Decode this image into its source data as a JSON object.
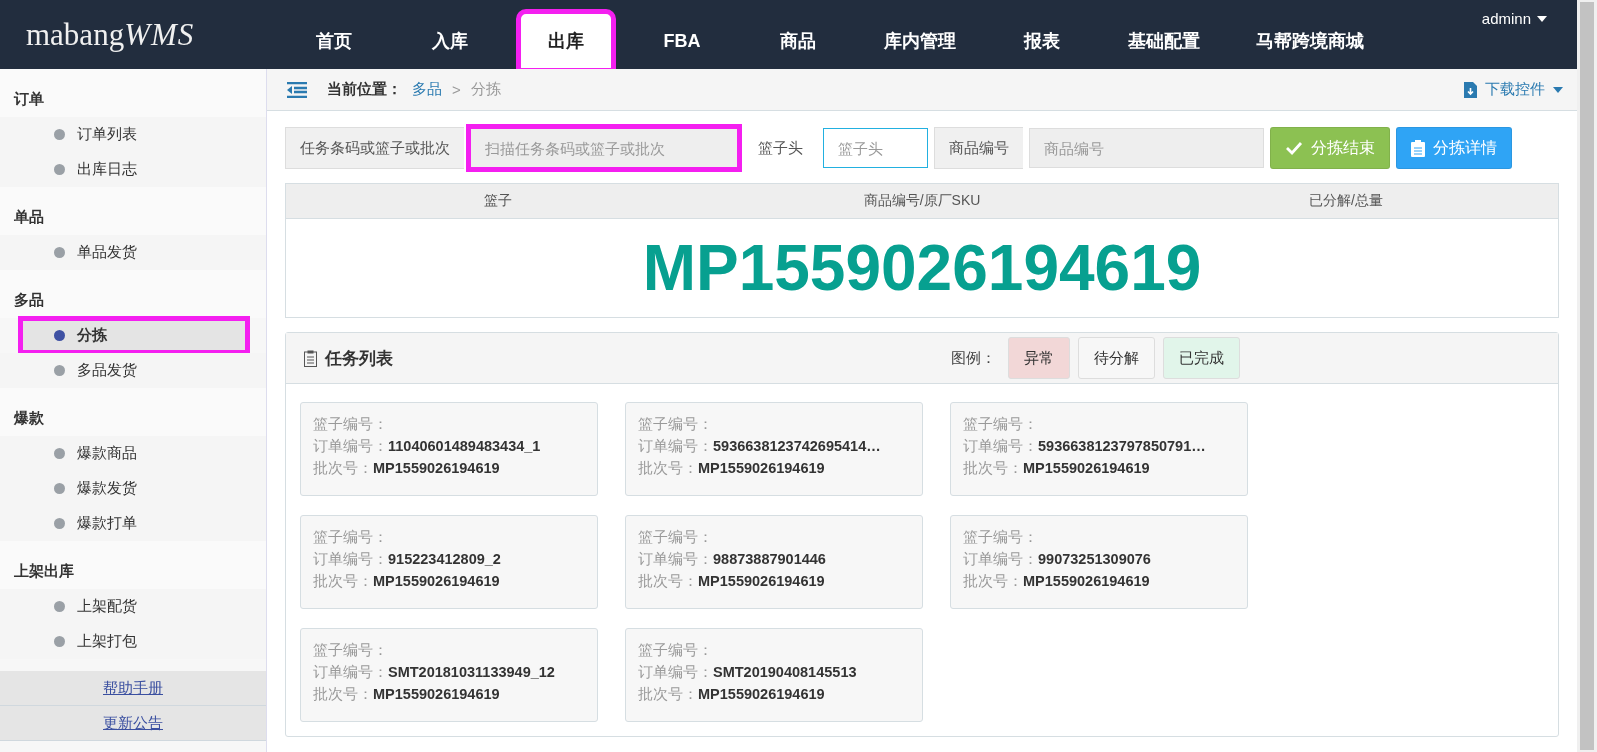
{
  "header": {
    "logo_text": "mabang",
    "logo_suffix": "WMS",
    "user": "adminn",
    "nav": [
      {
        "label": "首页",
        "selected": false,
        "highlighted": false
      },
      {
        "label": "入库",
        "selected": false,
        "highlighted": false
      },
      {
        "label": "出库",
        "selected": true,
        "highlighted": true
      },
      {
        "label": "FBA",
        "selected": false,
        "highlighted": false
      },
      {
        "label": "商品",
        "selected": false,
        "highlighted": false
      },
      {
        "label": "库内管理",
        "selected": false,
        "highlighted": false
      },
      {
        "label": "报表",
        "selected": false,
        "highlighted": false
      },
      {
        "label": "基础配置",
        "selected": false,
        "highlighted": false
      },
      {
        "label": "马帮跨境商城",
        "selected": false,
        "highlighted": false
      }
    ]
  },
  "sidebar": {
    "groups": [
      {
        "title": "订单",
        "items": [
          {
            "label": "订单列表",
            "selected": false,
            "highlighted": false
          },
          {
            "label": "出库日志",
            "selected": false,
            "highlighted": false
          }
        ]
      },
      {
        "title": "单品",
        "items": [
          {
            "label": "单品发货",
            "selected": false,
            "highlighted": false
          }
        ]
      },
      {
        "title": "多品",
        "items": [
          {
            "label": "分拣",
            "selected": true,
            "highlighted": true
          },
          {
            "label": "多品发货",
            "selected": false,
            "highlighted": false
          }
        ]
      },
      {
        "title": "爆款",
        "items": [
          {
            "label": "爆款商品",
            "selected": false,
            "highlighted": false
          },
          {
            "label": "爆款发货",
            "selected": false,
            "highlighted": false
          },
          {
            "label": "爆款打单",
            "selected": false,
            "highlighted": false
          }
        ]
      },
      {
        "title": "上架出库",
        "items": [
          {
            "label": "上架配货",
            "selected": false,
            "highlighted": false
          },
          {
            "label": "上架打包",
            "selected": false,
            "highlighted": false
          }
        ]
      }
    ],
    "links": [
      "帮助手册",
      "更新公告"
    ]
  },
  "breadcrumb": {
    "label": "当前位置：",
    "path": [
      "多品",
      "分拣"
    ],
    "separator": ">",
    "download": "下载控件"
  },
  "scan_form": {
    "fields": [
      {
        "label": "任务条码或篮子或批次",
        "placeholder": "扫描任务条码或篮子或批次",
        "highlighted": true,
        "focused": false
      },
      {
        "label": "篮子头",
        "placeholder": "篮子头",
        "highlighted": false,
        "focused": true
      },
      {
        "label": "商品编号",
        "placeholder": "商品编号",
        "highlighted": false,
        "focused": false
      }
    ],
    "buttons": [
      {
        "label": "分拣结束",
        "kind": "finish"
      },
      {
        "label": "分拣详情",
        "kind": "detail"
      }
    ]
  },
  "result_table": {
    "columns": [
      "篮子",
      "商品编号/原厂SKU",
      "已分解/总量"
    ],
    "batch": "MP1559026194619"
  },
  "task_list": {
    "title": "任务列表",
    "legend_label": "图例：",
    "legend": [
      {
        "label": "异常",
        "kind": "abnormal"
      },
      {
        "label": "待分解",
        "kind": "pending"
      },
      {
        "label": "已完成",
        "kind": "done"
      }
    ],
    "cards": [
      {
        "kind": "pending",
        "basket_label": "篮子编号：",
        "order_label": "订单编号：",
        "order": "11040601489483434_1",
        "batch_label": "批次号：",
        "batch": "MP1559026194619"
      },
      {
        "kind": "pending",
        "basket_label": "篮子编号：",
        "order_label": "订单编号：",
        "order": "5936638123742695414…",
        "batch_label": "批次号：",
        "batch": "MP1559026194619"
      },
      {
        "kind": "pending",
        "basket_label": "篮子编号：",
        "order_label": "订单编号：",
        "order": "5936638123797850791…",
        "batch_label": "批次号：",
        "batch": "MP1559026194619"
      },
      {
        "kind": "pending",
        "basket_label": "篮子编号：",
        "order_label": "订单编号：",
        "order": "915223412809_2",
        "batch_label": "批次号：",
        "batch": "MP1559026194619"
      },
      {
        "kind": "pending",
        "basket_label": "篮子编号：",
        "order_label": "订单编号：",
        "order": "98873887901446",
        "batch_label": "批次号：",
        "batch": "MP1559026194619"
      },
      {
        "kind": "pending",
        "basket_label": "篮子编号：",
        "order_label": "订单编号：",
        "order": "99073251309076",
        "batch_label": "批次号：",
        "batch": "MP1559026194619"
      },
      {
        "kind": "pending",
        "basket_label": "篮子编号：",
        "order_label": "订单编号：",
        "order": "SMT20181031133949_12",
        "batch_label": "批次号：",
        "batch": "MP1559026194619"
      },
      {
        "kind": "pending",
        "basket_label": "篮子编号：",
        "order_label": "订单编号：",
        "order": "SMT20190408145513",
        "batch_label": "批次号：",
        "batch": "MP1559026194619"
      }
    ]
  }
}
